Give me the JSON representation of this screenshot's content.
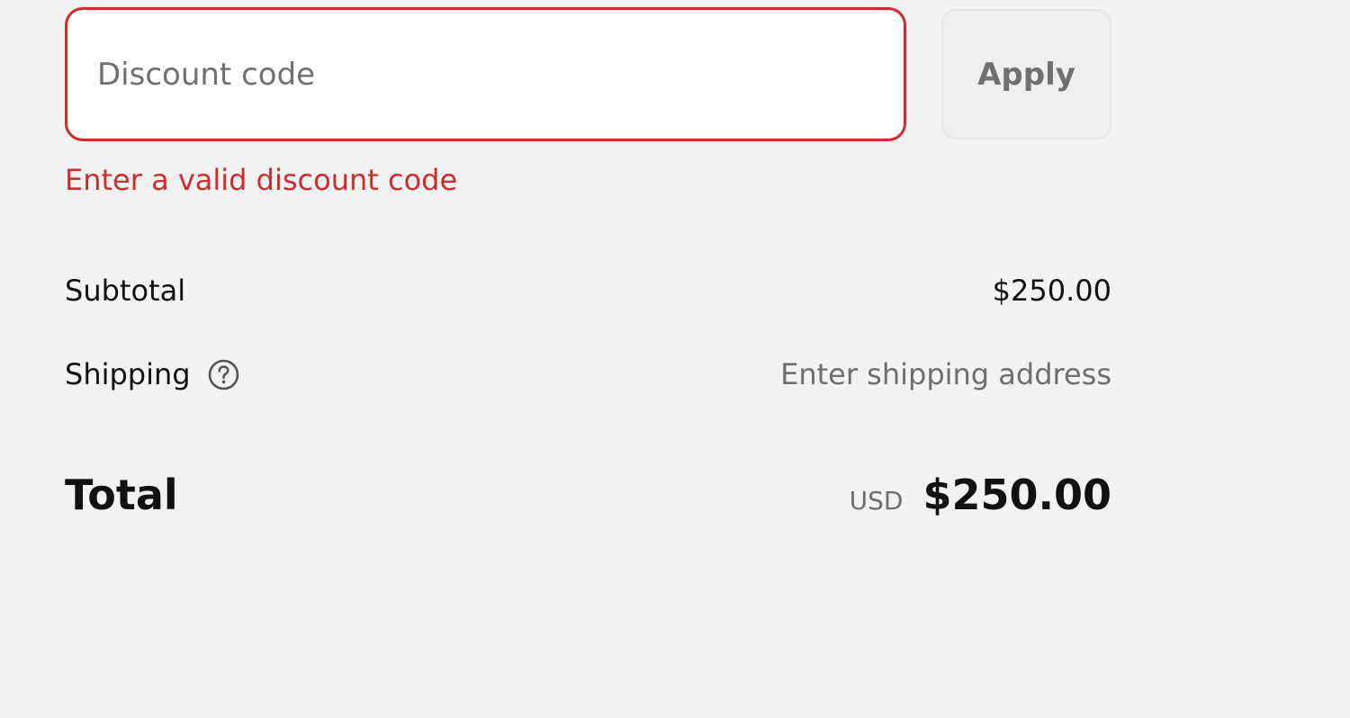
{
  "discount": {
    "placeholder": "Discount code",
    "value": "",
    "apply_label": "Apply",
    "error": "Enter a valid discount code"
  },
  "summary": {
    "subtotal_label": "Subtotal",
    "subtotal_value": "$250.00",
    "shipping_label": "Shipping",
    "shipping_value": "Enter shipping address",
    "shipping_help_icon": "question-circle-icon",
    "total_label": "Total",
    "currency": "USD",
    "total_value": "$250.00"
  },
  "colors": {
    "error": "#d12b2b",
    "background": "#f3f3f3",
    "muted_text": "#6e6e6e"
  }
}
